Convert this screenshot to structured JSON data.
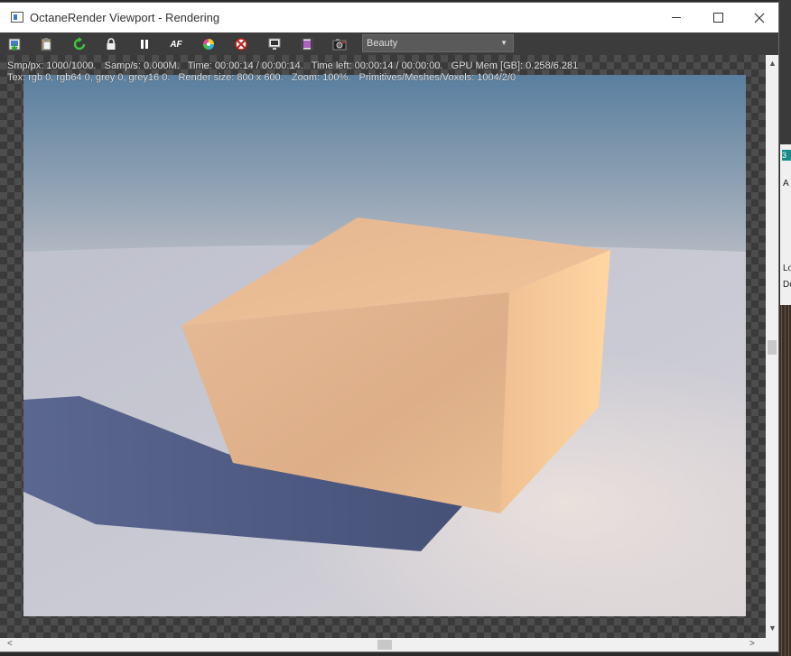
{
  "window": {
    "title": "OctaneRender Viewport - Rendering"
  },
  "toolbar": {
    "tools": [
      {
        "name": "export-icon"
      },
      {
        "name": "clipboard-icon"
      },
      {
        "name": "restart-icon"
      },
      {
        "name": "lock-icon"
      },
      {
        "name": "pause-icon"
      },
      {
        "name": "autofocus-icon",
        "label": "AF"
      },
      {
        "name": "color-wheel-icon"
      },
      {
        "name": "region-icon"
      },
      {
        "name": "display-icon"
      },
      {
        "name": "film-icon"
      },
      {
        "name": "camera-icon"
      }
    ],
    "pass_value": "Beauty"
  },
  "stats": {
    "line1": "Smp/px: 1000/1000.   Samp/s: 0.000M.   Time: 00:00:14 / 00:00:14.   Time left: 00:00:14 / 00:00:00.   GPU Mem [GB]: 0.258/6.281",
    "line2": "Tex: rgb 0, rgb64 0, grey 0, grey16 0.   Render size: 800 x 600.   Zoom: 100%.   Primitives/Meshes/Voxels: 1004/2/0"
  },
  "background_app": {
    "badge": "3",
    "text1": "A",
    "text2": "Lo",
    "text3": "Do"
  },
  "colors": {
    "sky_top": "#5a7f9f",
    "sky_horizon": "#b8bcc4",
    "floor": "#c8c8d2",
    "shadow": "#4a5a85",
    "box_top": "#e8b890",
    "box_front": "#e4b590",
    "box_side": "#f8cc98"
  }
}
